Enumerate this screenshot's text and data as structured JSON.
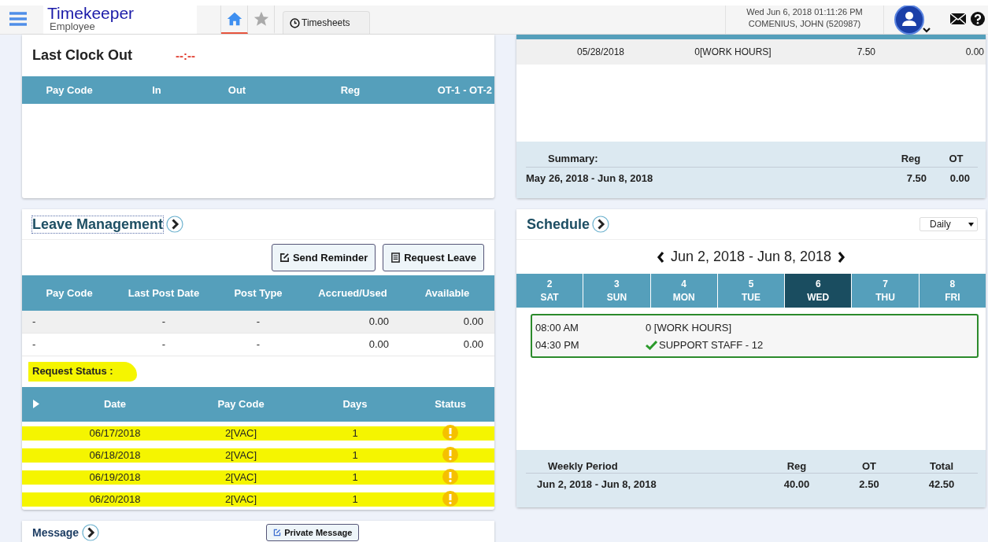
{
  "header": {
    "app_title": "Timekeeper",
    "app_subtitle": "Employee",
    "nav": [
      {
        "kind": "home",
        "selected": true
      },
      {
        "kind": "star",
        "selected": false
      }
    ],
    "tabs": [
      {
        "label": "Timesheets",
        "selected": false
      }
    ],
    "datetime": "Wed Jun 6, 2018 01:11:26 PM",
    "user": "COMENIUS, JOHN (520987)"
  },
  "clock_card": {
    "last_clock_out_label": "Last Clock Out",
    "last_clock_out_value": "--:--",
    "columns": [
      "Pay Code",
      "In",
      "Out",
      "Reg",
      "OT-1 - OT-2"
    ]
  },
  "leave_management": {
    "title": "Leave Management",
    "buttons": [
      {
        "kind": "reminder",
        "label": "Send Reminder"
      },
      {
        "kind": "request",
        "label": "Request Leave"
      }
    ],
    "columns": [
      "Pay Code",
      "Last Post Date",
      "Post Type",
      "Accrued/Used",
      "Available"
    ],
    "rows": [
      [
        "-",
        "-",
        "-",
        "0.00",
        "0.00"
      ],
      [
        "-",
        "-",
        "-",
        "0.00",
        "0.00"
      ]
    ],
    "request_status": {
      "label": "Request Status :",
      "highlighted": true,
      "columns": [
        "Date",
        "Pay Code",
        "Days",
        "Status"
      ],
      "rows": [
        {
          "date": "06/17/2018",
          "pay_code": "2[VAC]",
          "days": "1",
          "kind": "pending",
          "highlighted": true
        },
        {
          "date": "06/18/2018",
          "pay_code": "2[VAC]",
          "days": "1",
          "kind": "pending",
          "highlighted": true
        },
        {
          "date": "06/19/2018",
          "pay_code": "2[VAC]",
          "days": "1",
          "kind": "pending",
          "highlighted": true
        },
        {
          "date": "06/20/2018",
          "pay_code": "2[VAC]",
          "days": "1",
          "kind": "pending",
          "highlighted": true
        }
      ]
    }
  },
  "message": {
    "title": "Message",
    "button": "Private Message"
  },
  "timesheet": {
    "rows": [
      [
        "05/28/2018",
        "0[WORK HOURS]",
        "7.50",
        "0.00"
      ]
    ],
    "summary": {
      "label": "Summary:",
      "columns": [
        "Reg",
        "OT"
      ],
      "period": "May 26, 2018 - Jun 8, 2018",
      "values": [
        "7.50",
        "0.00"
      ]
    }
  },
  "schedule": {
    "title": "Schedule",
    "view": "Daily",
    "range": "Jun 2, 2018 - Jun 8, 2018",
    "days": [
      {
        "date": "2",
        "weekday": "SAT",
        "selected": false
      },
      {
        "date": "3",
        "weekday": "SUN",
        "selected": false
      },
      {
        "date": "4",
        "weekday": "MON",
        "selected": false
      },
      {
        "date": "5",
        "weekday": "TUE",
        "selected": false
      },
      {
        "date": "6",
        "weekday": "WED",
        "selected": true
      },
      {
        "date": "7",
        "weekday": "THU",
        "selected": false
      },
      {
        "date": "8",
        "weekday": "FRI",
        "selected": false
      }
    ],
    "events": [
      {
        "time": "08:00 AM",
        "text": "0 [WORK HOURS]",
        "confirmed": false
      },
      {
        "time": "04:30 PM",
        "text": "SUPPORT STAFF - 12",
        "confirmed": true
      }
    ],
    "weekly": {
      "label": "Weekly Period",
      "columns": [
        "Reg",
        "OT",
        "Total"
      ],
      "period": "Jun 2, 2018 - Jun 8, 2018",
      "values": [
        "40.00",
        "2.50",
        "42.50"
      ]
    }
  }
}
